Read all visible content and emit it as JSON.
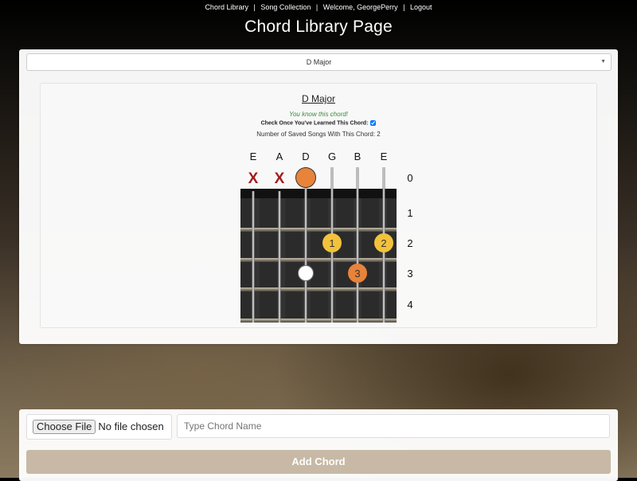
{
  "nav": {
    "items": [
      "Chord Library",
      "Song Collection",
      "Welcome, GeorgePerry",
      "Logout"
    ],
    "separator": "|"
  },
  "page_title": "Chord Library Page",
  "chord_select": {
    "selected": "D Major"
  },
  "chord": {
    "name": "D Major",
    "known_text": "You know this chord!",
    "learned_label": "Check Once You've Learned This Chord:",
    "learned_checked": true,
    "saved_songs_text": "Number of Saved Songs With This Chord: 2",
    "strings": [
      "E",
      "A",
      "D",
      "G",
      "B",
      "E"
    ],
    "muted_marker": "X",
    "fret_numbers": [
      "0",
      "1",
      "2",
      "3",
      "4"
    ],
    "open_strings_muted": [
      0,
      1
    ],
    "open_root_string": 2,
    "fingers": [
      {
        "string": 3,
        "fret": 2,
        "label": "1",
        "color": "#f3c23c"
      },
      {
        "string": 5,
        "fret": 2,
        "label": "2",
        "color": "#f3c23c"
      },
      {
        "string": 4,
        "fret": 3,
        "label": "3",
        "color": "#e8833a"
      }
    ],
    "ghost_notes": [
      {
        "string": 2,
        "fret": 3
      }
    ]
  },
  "colors": {
    "root": "#e8833a",
    "finger": "#f3c23c",
    "muted": "#a31d1d",
    "known": "#3c8a3c",
    "add_button": "#c7b9a5"
  },
  "upload": {
    "button_label": "Choose File",
    "status": "No file chosen",
    "chord_name_placeholder": "Type Chord Name",
    "add_label": "Add Chord"
  }
}
